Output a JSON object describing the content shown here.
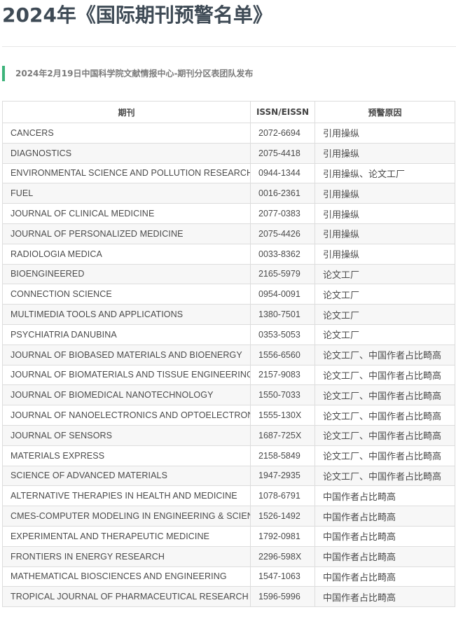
{
  "title": "2024年《国际期刊预警名单》",
  "subtitle": "2024年2月19日中国科学院文献情报中心-期刊分区表团队发布",
  "accent_color": "#3db37a",
  "table": {
    "headers": [
      "期刊",
      "ISSN/EISSN",
      "预警原因"
    ],
    "rows": [
      {
        "journal": "CANCERS",
        "issn": "2072-6694",
        "reason": "引用操纵"
      },
      {
        "journal": "DIAGNOSTICS",
        "issn": "2075-4418",
        "reason": "引用操纵"
      },
      {
        "journal": "ENVIRONMENTAL SCIENCE AND POLLUTION RESEARCH",
        "issn": "0944-1344",
        "reason": "引用操纵、论文工厂"
      },
      {
        "journal": "FUEL",
        "issn": "0016-2361",
        "reason": "引用操纵"
      },
      {
        "journal": "JOURNAL OF CLINICAL MEDICINE",
        "issn": "2077-0383",
        "reason": "引用操纵"
      },
      {
        "journal": "JOURNAL OF PERSONALIZED MEDICINE",
        "issn": "2075-4426",
        "reason": "引用操纵"
      },
      {
        "journal": "RADIOLOGIA MEDICA",
        "issn": "0033-8362",
        "reason": "引用操纵"
      },
      {
        "journal": "BIOENGINEERED",
        "issn": "2165-5979",
        "reason": "论文工厂"
      },
      {
        "journal": "CONNECTION SCIENCE",
        "issn": "0954-0091",
        "reason": "论文工厂"
      },
      {
        "journal": "MULTIMEDIA TOOLS AND APPLICATIONS",
        "issn": "1380-7501",
        "reason": "论文工厂"
      },
      {
        "journal": "PSYCHIATRIA DANUBINA",
        "issn": "0353-5053",
        "reason": "论文工厂"
      },
      {
        "journal": "JOURNAL OF BIOBASED MATERIALS AND BIOENERGY",
        "issn": "1556-6560",
        "reason": "论文工厂、中国作者占比畸高"
      },
      {
        "journal": "JOURNAL OF BIOMATERIALS AND TISSUE ENGINEERING",
        "issn": "2157-9083",
        "reason": "论文工厂、中国作者占比畸高"
      },
      {
        "journal": "JOURNAL OF BIOMEDICAL NANOTECHNOLOGY",
        "issn": "1550-7033",
        "reason": "论文工厂、中国作者占比畸高"
      },
      {
        "journal": "JOURNAL OF NANOELECTRONICS AND OPTOELECTRONICS",
        "issn": "1555-130X",
        "reason": "论文工厂、中国作者占比畸高"
      },
      {
        "journal": "JOURNAL OF SENSORS",
        "issn": "1687-725X",
        "reason": "论文工厂、中国作者占比畸高"
      },
      {
        "journal": "MATERIALS EXPRESS",
        "issn": "2158-5849",
        "reason": "论文工厂、中国作者占比畸高"
      },
      {
        "journal": "SCIENCE OF ADVANCED MATERIALS",
        "issn": "1947-2935",
        "reason": "论文工厂、中国作者占比畸高"
      },
      {
        "journal": "ALTERNATIVE THERAPIES IN HEALTH AND MEDICINE",
        "issn": "1078-6791",
        "reason": "中国作者占比畸高"
      },
      {
        "journal": "CMES-COMPUTER MODELING IN ENGINEERING & SCIENCES",
        "issn": "1526-1492",
        "reason": "中国作者占比畸高"
      },
      {
        "journal": "EXPERIMENTAL AND THERAPEUTIC MEDICINE",
        "issn": "1792-0981",
        "reason": "中国作者占比畸高"
      },
      {
        "journal": "FRONTIERS IN ENERGY RESEARCH",
        "issn": "2296-598X",
        "reason": "中国作者占比畸高"
      },
      {
        "journal": "MATHEMATICAL BIOSCIENCES AND ENGINEERING",
        "issn": "1547-1063",
        "reason": "中国作者占比畸高"
      },
      {
        "journal": "TROPICAL JOURNAL OF PHARMACEUTICAL RESEARCH",
        "issn": "1596-5996",
        "reason": "中国作者占比畸高"
      }
    ]
  }
}
